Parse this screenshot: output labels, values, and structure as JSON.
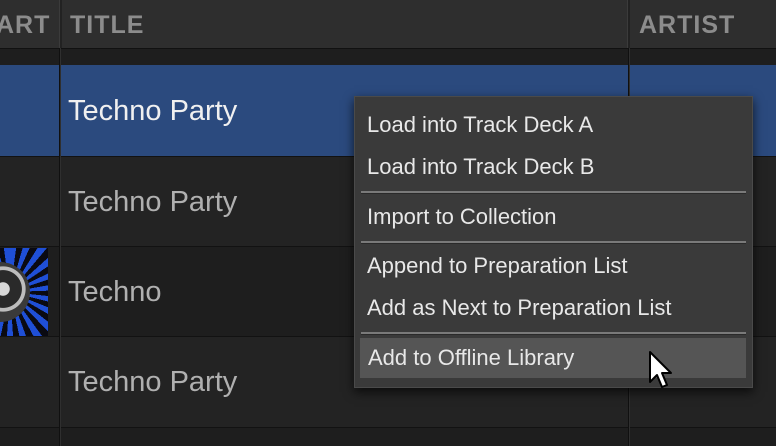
{
  "table": {
    "columns": [
      {
        "label": "ART"
      },
      {
        "label": "TITLE"
      },
      {
        "label": "ARTIST"
      }
    ],
    "rows": [
      {
        "title": "Techno Party",
        "artist": "",
        "selected": true
      },
      {
        "title": "Techno Party",
        "artist": "",
        "selected": false
      },
      {
        "title": "Techno",
        "artist": "",
        "selected": false
      },
      {
        "title": "Techno Party",
        "artist": "",
        "selected": false
      }
    ]
  },
  "context_menu": {
    "items": [
      {
        "label": "Load into Track Deck A"
      },
      {
        "label": "Load into Track Deck B"
      },
      {
        "label": "Import to Collection"
      },
      {
        "label": "Append to Preparation List"
      },
      {
        "label": "Add as Next to Preparation List"
      },
      {
        "label": "Add to Offline Library",
        "hovered": true
      }
    ]
  },
  "colors": {
    "selection": "#2b4a7e",
    "menu_background": "#3a3a3a",
    "menu_hover": "#555555",
    "artwork_accent": "#1f4fd6"
  },
  "icons": {
    "cursor": "mouse-pointer-icon"
  }
}
